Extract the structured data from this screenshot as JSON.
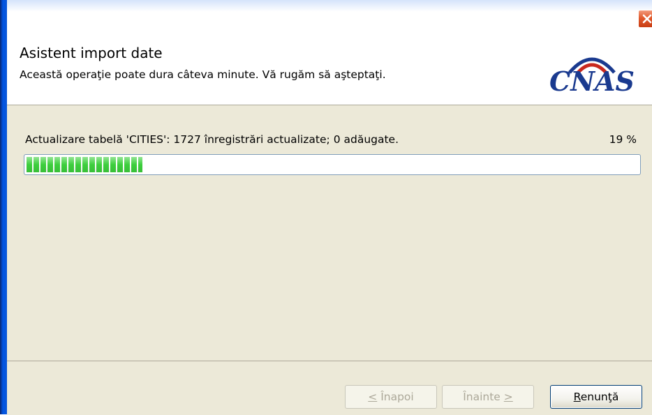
{
  "header": {
    "title": "Asistent import date",
    "subtitle": "Această operaţie poate dura câteva minute. Vă rugăm să aşteptaţi.",
    "logo_text": "CNAS"
  },
  "progress": {
    "status": "Actualizare tabelă 'CITIES': 1727 înregistrări actualizate; 0 adăugate.",
    "percent_label": "19 %",
    "value": 0.19,
    "color": "#3dcf3d"
  },
  "buttons": {
    "back": {
      "key": "<",
      "label": " Înapoi"
    },
    "next": {
      "label": "Înainte ",
      "key": ">"
    },
    "cancel": {
      "key": "R",
      "label": "enunţă"
    }
  },
  "colors": {
    "close": "#e15a2d",
    "panel": "#ece9d8",
    "logo_blue": "#1a3a8f",
    "logo_red": "#c8281e"
  },
  "icons": {
    "close": "close-icon"
  }
}
